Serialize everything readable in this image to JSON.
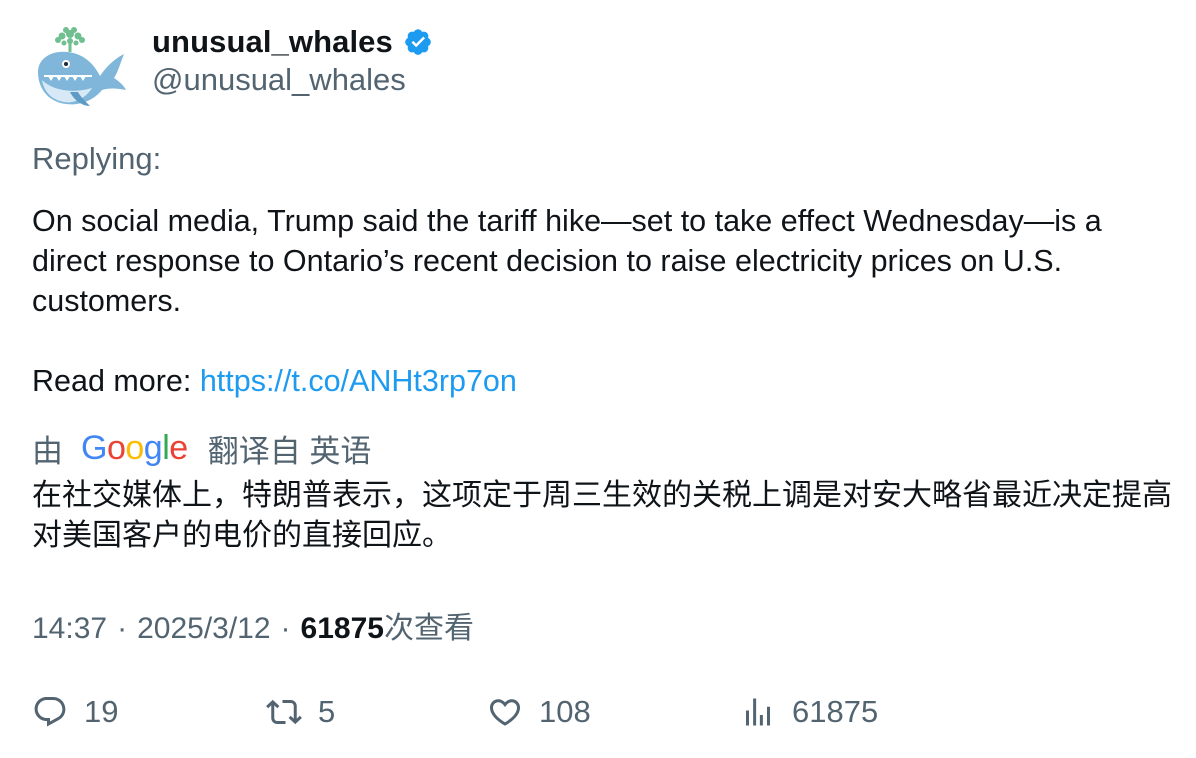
{
  "user": {
    "display_name": "unusual_whales",
    "handle": "@unusual_whales"
  },
  "tweet": {
    "replying_label": "Replying:",
    "text_lines": [
      "On social media, Trump said the tariff hike—set to take effect Wednesday—is a",
      "direct response to Ontario’s recent decision to raise electricity prices on U.S.",
      "customers."
    ],
    "read_more_label": "Read more: ",
    "link": "https://t.co/ANHt3rp7on"
  },
  "translation": {
    "by_label": "由",
    "provider": "Google",
    "source_label": "翻译自 英语",
    "translated_text": "在社交媒体上，特朗普表示，这项定于周三生效的关税上调是对安大略省最近决定提高对美国客户的电价的直接回应。"
  },
  "meta": {
    "time": "14:37",
    "date": "2025/3/12",
    "views_count": "61875",
    "views_label": "次查看"
  },
  "actions": {
    "replies": "19",
    "retweets": "5",
    "likes": "108",
    "views": "61875"
  },
  "colors": {
    "accent": "#1d9bf0",
    "secondary_text": "#536471",
    "primary_text": "#0f1419"
  },
  "icons": [
    "verified-badge-icon",
    "reply-icon",
    "retweet-icon",
    "like-icon",
    "views-icon"
  ]
}
